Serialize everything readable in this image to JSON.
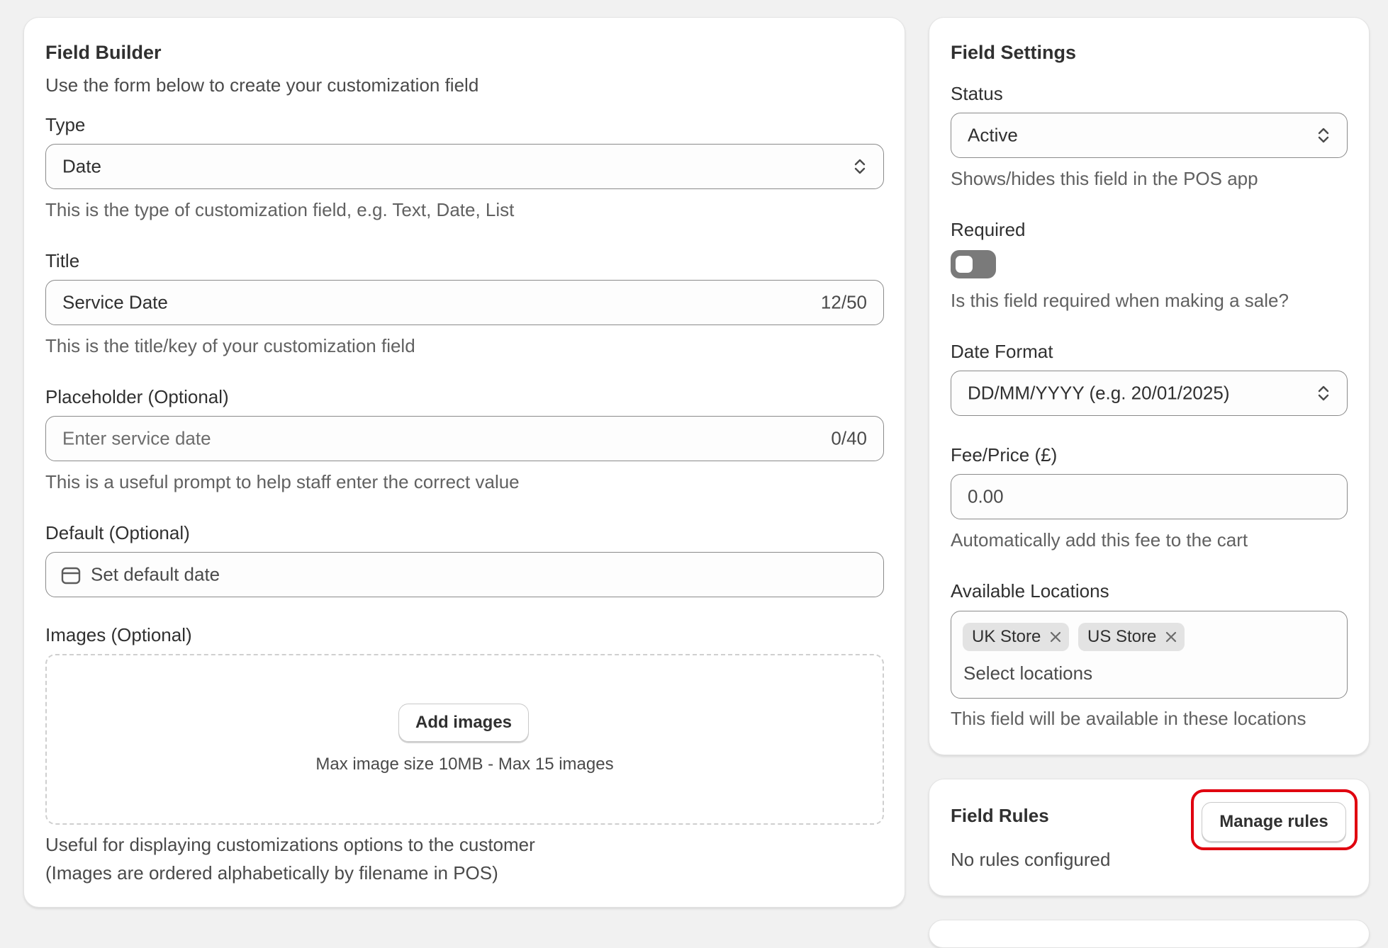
{
  "builder": {
    "title": "Field Builder",
    "subtitle": "Use the form below to create your customization field",
    "type": {
      "label": "Type",
      "value": "Date",
      "help": "This is the type of customization field, e.g. Text, Date, List"
    },
    "title_field": {
      "label": "Title",
      "value": "Service Date",
      "count": "12/50",
      "help": "This is the title/key of your customization field"
    },
    "placeholder_field": {
      "label": "Placeholder (Optional)",
      "placeholder": "Enter service date",
      "count": "0/40",
      "help": "This is a useful prompt to help staff enter the correct value"
    },
    "default_field": {
      "label": "Default (Optional)",
      "placeholder": "Set default date",
      "icon": "calendar-icon"
    },
    "images": {
      "label": "Images (Optional)",
      "button": "Add images",
      "limits": "Max image size 10MB - Max 15 images",
      "help_line1": "Useful for displaying customizations options to the customer",
      "help_line2": "(Images are ordered alphabetically by filename in POS)"
    }
  },
  "settings": {
    "title": "Field Settings",
    "status": {
      "label": "Status",
      "value": "Active",
      "help": "Shows/hides this field in the POS app"
    },
    "required": {
      "label": "Required",
      "enabled": false,
      "help": "Is this field required when making a sale?"
    },
    "date_format": {
      "label": "Date Format",
      "value": "DD/MM/YYYY (e.g. 20/01/2025)"
    },
    "fee": {
      "label": "Fee/Price (£)",
      "placeholder": "0.00",
      "help": "Automatically add this fee to the cart"
    },
    "locations": {
      "label": "Available Locations",
      "tags": [
        "UK Store",
        "US Store"
      ],
      "placeholder": "Select locations",
      "help": "This field will be available in these locations"
    }
  },
  "rules": {
    "title": "Field Rules",
    "button": "Manage rules",
    "status": "No rules configured"
  },
  "colors": {
    "page_bg": "#f1f1f1",
    "card_bg": "#ffffff",
    "highlight": "#e0000f",
    "toggle_off": "#7a7a7a"
  }
}
